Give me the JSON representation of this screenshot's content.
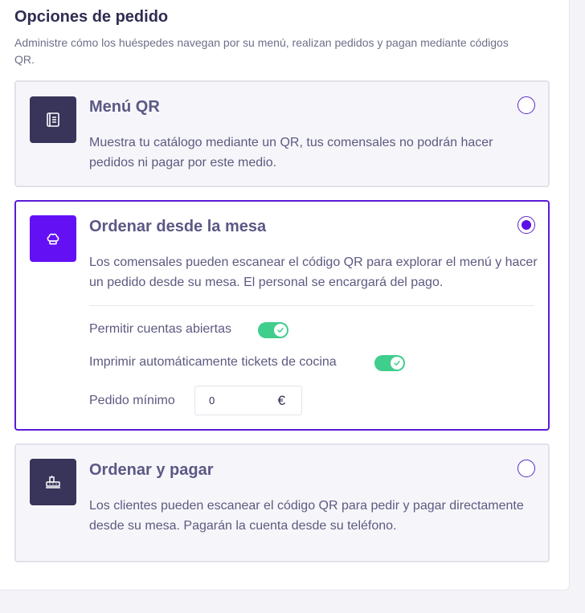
{
  "header": {
    "title": "Opciones de pedido",
    "subtitle": "Administre cómo los huéspedes navegan por su menú, realizan pedidos y pagan mediante códigos QR."
  },
  "options": [
    {
      "title": "Menú QR",
      "description": "Muestra tu catálogo mediante un QR, tus comensales no podrán hacer pedidos ni pagar por este medio.",
      "icon": "menu-book-icon",
      "selected": false
    },
    {
      "title": "Ordenar desde la mesa",
      "description": "Los comensales pueden escanear el código QR para explorar el menú y hacer un pedido desde su mesa. El personal se encargará del pago.",
      "icon": "chef-hat-icon",
      "selected": true,
      "settings": {
        "open_accounts_label": "Permitir cuentas abiertas",
        "open_accounts_on": true,
        "auto_print_label": "Imprimir automáticamente tickets de cocina",
        "auto_print_on": true,
        "min_order_label": "Pedido mínimo",
        "min_order_value": "0",
        "currency": "€"
      }
    },
    {
      "title": "Ordenar y pagar",
      "description": "Los clientes pueden escanear el código QR para pedir y pagar directamente desde su mesa. Pagarán la cuenta desde su teléfono.",
      "icon": "cash-register-icon",
      "selected": false
    }
  ],
  "colors": {
    "accent": "#5a10e6",
    "icon_bg": "#38345a",
    "icon_bg_selected": "#6410f5",
    "toggle_on": "#3fce8c"
  }
}
